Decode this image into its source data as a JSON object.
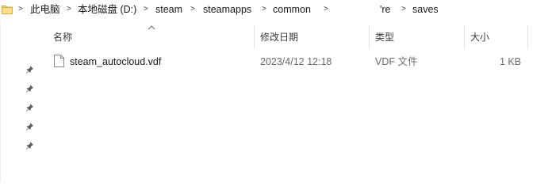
{
  "address_bar": {
    "crumbs": [
      {
        "label": "此电脑"
      },
      {
        "label": "本地磁盘 (D:)"
      },
      {
        "label": "steam"
      },
      {
        "label": "steamapps"
      },
      {
        "label": "common"
      },
      {
        "label": "'re"
      },
      {
        "label": "saves"
      }
    ]
  },
  "columns": {
    "name": "名称",
    "modified": "修改日期",
    "type": "类型",
    "size": "大小"
  },
  "files": [
    {
      "name": "steam_autocloud.vdf",
      "modified": "2023/4/12 12:18",
      "type": "VDF 文件",
      "size": "1 KB"
    }
  ],
  "icons": {
    "folder": "folder-icon",
    "pin": "pin-icon",
    "file": "file-icon",
    "sort": "sort-ascending-icon"
  }
}
